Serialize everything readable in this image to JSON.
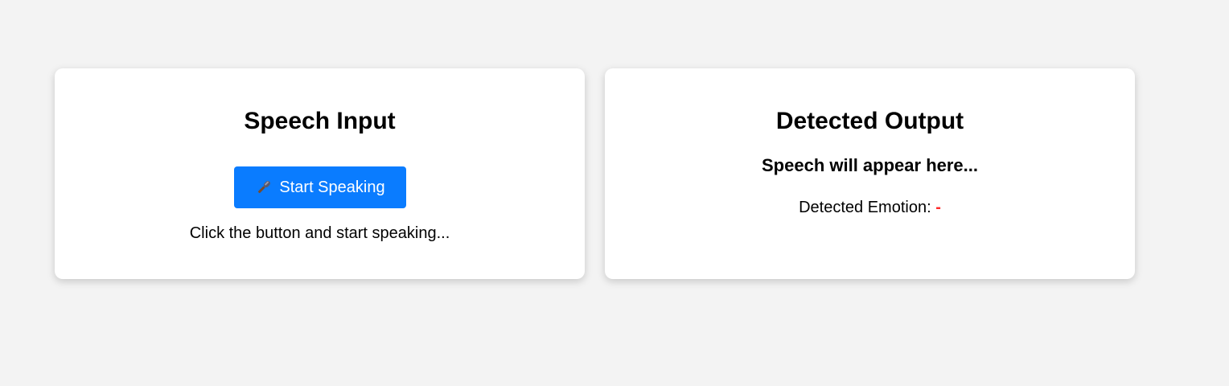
{
  "input_card": {
    "title": "Speech Input",
    "button_label": "Start Speaking",
    "button_icon": "microphone-icon",
    "hint": "Click the button and start speaking..."
  },
  "output_card": {
    "title": "Detected Output",
    "speech_text": "Speech will appear here...",
    "emotion_label": "Detected Emotion: ",
    "emotion_value": "-"
  },
  "colors": {
    "background": "#f3f3f3",
    "card": "#ffffff",
    "button": "#0a7cff",
    "emotion_value": "#ff2a2a"
  }
}
